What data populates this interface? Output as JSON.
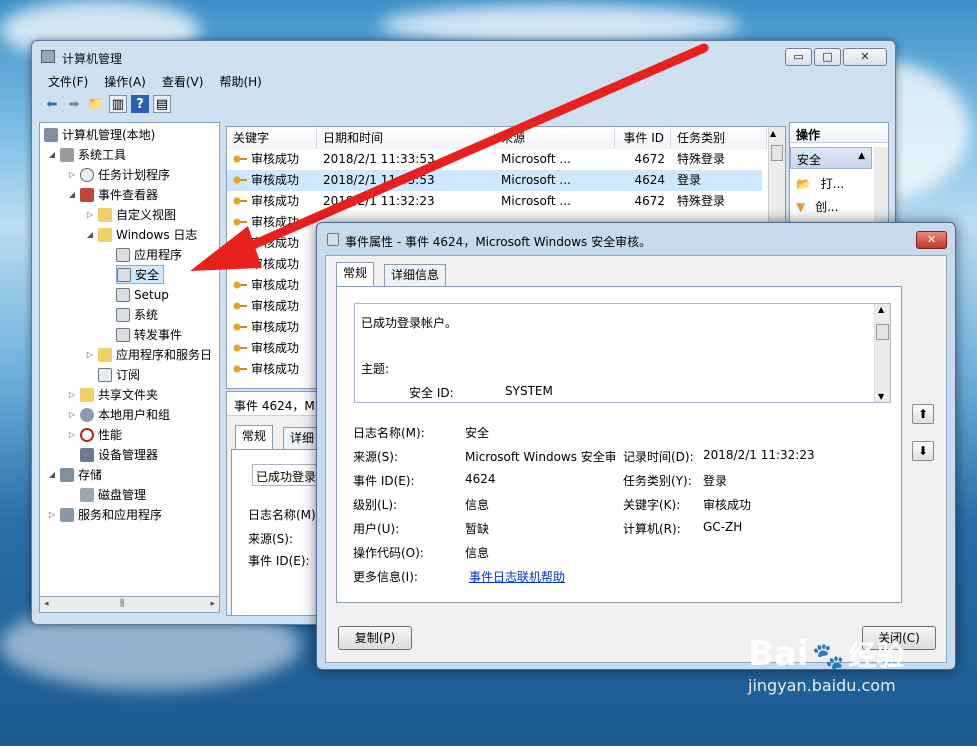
{
  "main_window": {
    "title": "计算机管理",
    "menu": [
      "文件(F)",
      "操作(A)",
      "查看(V)",
      "帮助(H)"
    ],
    "tree": [
      {
        "label": "计算机管理(本地)",
        "level": 0
      },
      {
        "label": "系统工具",
        "level": 1
      },
      {
        "label": "任务计划程序",
        "level": 2
      },
      {
        "label": "事件查看器",
        "level": 2
      },
      {
        "label": "自定义视图",
        "level": 3
      },
      {
        "label": "Windows 日志",
        "level": 3
      },
      {
        "label": "应用程序",
        "level": 4
      },
      {
        "label": "安全",
        "level": 4
      },
      {
        "label": "Setup",
        "level": 4
      },
      {
        "label": "系统",
        "level": 4
      },
      {
        "label": "转发事件",
        "level": 4
      },
      {
        "label": "应用程序和服务日",
        "level": 3
      },
      {
        "label": "订阅",
        "level": 3
      },
      {
        "label": "共享文件夹",
        "level": 2
      },
      {
        "label": "本地用户和组",
        "level": 2
      },
      {
        "label": "性能",
        "level": 2
      },
      {
        "label": "设备管理器",
        "level": 2
      },
      {
        "label": "存储",
        "level": 1
      },
      {
        "label": "磁盘管理",
        "level": 2
      },
      {
        "label": "服务和应用程序",
        "level": 1
      }
    ],
    "list_columns": [
      "关键字",
      "日期和时间",
      "来源",
      "事件 ID",
      "任务类别"
    ],
    "list_rows": [
      [
        "审核成功",
        "2018/2/1 11:33:53",
        "Microsoft ...",
        "4672",
        "特殊登录"
      ],
      [
        "审核成功",
        "2018/2/1 11:33:53",
        "Microsoft ...",
        "4624",
        "登录"
      ],
      [
        "审核成功",
        "2018/2/1 11:32:23",
        "Microsoft ...",
        "4672",
        "特殊登录"
      ],
      [
        "审核成功",
        "",
        "",
        "",
        ""
      ],
      [
        "审核成功",
        "",
        "",
        "",
        ""
      ],
      [
        "审核成功",
        "",
        "",
        "",
        ""
      ],
      [
        "审核成功",
        "",
        "",
        "",
        ""
      ],
      [
        "审核成功",
        "",
        "",
        "",
        ""
      ],
      [
        "审核成功",
        "",
        "",
        "",
        ""
      ],
      [
        "审核成功",
        "",
        "",
        "",
        ""
      ],
      [
        "审核成功",
        "",
        "",
        "",
        ""
      ]
    ],
    "detail_header": "事件 4624，Mi",
    "detail_tabs": [
      "常规",
      "详细"
    ],
    "detail_desc": "已成功登录帐",
    "detail_labels": [
      "日志名称(M):",
      "来源(S):",
      "事件 ID(E):"
    ],
    "actions_title": "操作",
    "actions_section": "安全",
    "actions_items": [
      "打...",
      "创..."
    ]
  },
  "dialog": {
    "title": "事件属性 - 事件 4624，Microsoft Windows 安全审核。",
    "tabs": [
      "常规",
      "详细信息"
    ],
    "description_line1": "已成功登录帐户。",
    "description_line2": "主题:",
    "description_line3_label": "安全 ID:",
    "description_line3_value": "SYSTEM",
    "fields_left": [
      {
        "label": "日志名称(M):",
        "value": "安全"
      },
      {
        "label": "来源(S):",
        "value": "Microsoft Windows 安全审"
      },
      {
        "label": "事件 ID(E):",
        "value": "4624"
      },
      {
        "label": "级别(L):",
        "value": "信息"
      },
      {
        "label": "用户(U):",
        "value": "暂缺"
      },
      {
        "label": "操作代码(O):",
        "value": "信息"
      },
      {
        "label": "更多信息(I):",
        "value": "事件日志联机帮助"
      }
    ],
    "fields_right": [
      {
        "label": "记录时间(D):",
        "value": "2018/2/1 11:32:23"
      },
      {
        "label": "任务类别(Y):",
        "value": "登录"
      },
      {
        "label": "关键字(K):",
        "value": "审核成功"
      },
      {
        "label": "计算机(R):",
        "value": "GC-ZH"
      }
    ],
    "copy_button": "复制(P)",
    "close_button": "关闭(C)"
  },
  "watermark": {
    "brand": "Bai",
    "brand2": "经验",
    "url": "jingyan.baidu.com"
  },
  "colors": {
    "arrow": "#e8211c",
    "link": "#0033cc",
    "selection": "#cde8ff"
  }
}
